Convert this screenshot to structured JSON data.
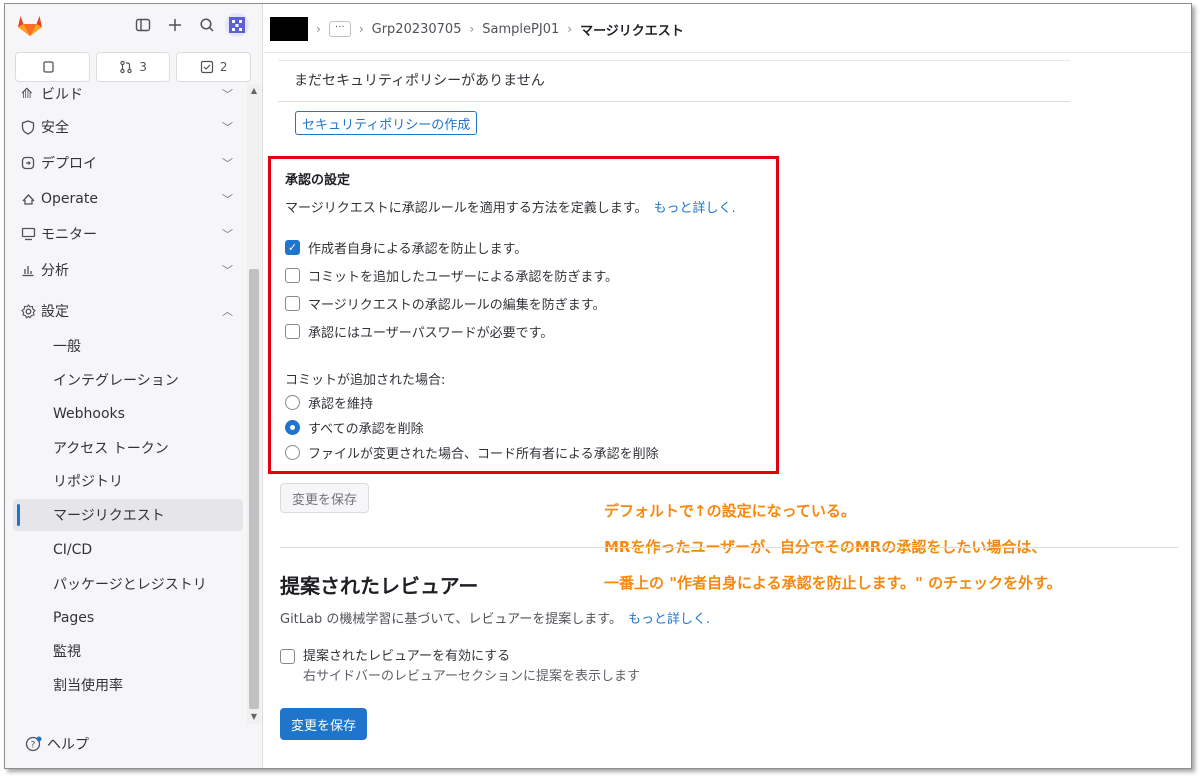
{
  "sidebar": {
    "counters": [
      {
        "icon": "issues-icon",
        "count": ""
      },
      {
        "icon": "merge-request-icon",
        "count": "3"
      },
      {
        "icon": "todo-icon",
        "count": "2"
      }
    ],
    "nav": [
      {
        "label": "ビルド",
        "icon": "rocket-icon"
      },
      {
        "label": "安全",
        "icon": "shield-icon"
      },
      {
        "label": "デプロイ",
        "icon": "deploy-icon"
      },
      {
        "label": "Operate",
        "icon": "cloud-icon"
      },
      {
        "label": "モニター",
        "icon": "monitor-icon"
      },
      {
        "label": "分析",
        "icon": "chart-icon"
      },
      {
        "label": "設定",
        "icon": "gear-icon"
      }
    ],
    "sub_items": [
      "一般",
      "インテグレーション",
      "Webhooks",
      "アクセス トークン",
      "リポジトリ",
      "マージリクエスト",
      "CI/CD",
      "パッケージとレジストリ",
      "Pages",
      "監視",
      "割当使用率"
    ],
    "help_label": "ヘルプ"
  },
  "breadcrumb": {
    "items": [
      "Grp20230705",
      "SamplePJ01",
      "マージリクエスト"
    ]
  },
  "policy": {
    "empty_text": "まだセキュリティポリシーがありません",
    "create_button": "セキュリティポリシーの作成"
  },
  "approval": {
    "title": "承認の設定",
    "description": "マージリクエストに承認ルールを適用する方法を定義します。",
    "more_link": "もっと詳しく.",
    "checkboxes": [
      {
        "label": "作成者自身による承認を防止します。",
        "checked": true
      },
      {
        "label": "コミットを追加したユーザーによる承認を防ぎます。",
        "checked": false
      },
      {
        "label": "マージリクエストの承認ルールの編集を防ぎます。",
        "checked": false
      },
      {
        "label": "承認にはユーザーパスワードが必要です。",
        "checked": false
      }
    ],
    "radio_heading": "コミットが追加された場合:",
    "radios": [
      {
        "label": "承認を維持",
        "checked": false
      },
      {
        "label": "すべての承認を削除",
        "checked": true
      },
      {
        "label": "ファイルが変更された場合、コード所有者による承認を削除",
        "checked": false
      }
    ],
    "save_button": "変更を保存"
  },
  "reviewers": {
    "title": "提案されたレビュアー",
    "description": "GitLab の機械学習に基づいて、レビュアーを提案します。",
    "more_link": "もっと詳しく.",
    "checkbox_label": "提案されたレビュアーを有効にする",
    "checkbox_help": "右サイドバーのレビュアーセクションに提案を表示します",
    "save_button": "変更を保存"
  },
  "annotation": {
    "line1": "デフォルトで↑の設定になっている。",
    "line2": "MRを作ったユーザーが、自分でそのMRの承認をしたい場合は、",
    "line3": "一番上の \"作者自身による承認を防止します。\" のチェックを外す。"
  },
  "colors": {
    "accent": "#1f75cb",
    "highlight_border": "#e3000f",
    "annotation": "#f5890f"
  }
}
